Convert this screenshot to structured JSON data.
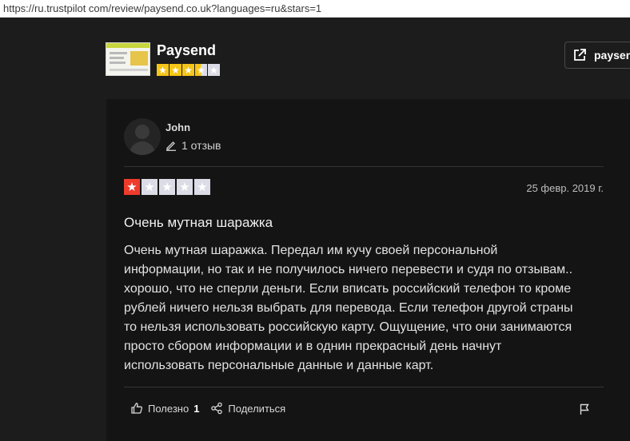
{
  "browser": {
    "url": "https://ru.trustpilot com/review/paysend.co.uk?languages=ru&stars=1"
  },
  "company": {
    "name": "Paysend",
    "stars": 3.5,
    "visit_label": "paysen",
    "star_color": "#f5c518"
  },
  "review": {
    "author": "John",
    "review_count": "1 отзыв",
    "rating": 1,
    "rating_color": "#ee3b2c",
    "date": "25 февр. 2019 г.",
    "title": "Очень мутная шаражка",
    "body_lines": [
      "Очень мутная шаражка. Передал им кучу своей персональной",
      "информации, но так и не получилось ничего перевести и судя по отзывам..",
      "хорошо, что не сперли деньги. Если вписать российский телефон то кроме",
      "рублей ничего нельзя выбрать для перевода. Если телефон другой страны",
      "то нельзя использовать российскую карту. Ощущение, что они занимаются",
      "просто сбором информации и в однин прекрасный день начнут",
      "использовать персональные данные и данные карт."
    ]
  },
  "actions": {
    "useful_label": "Полезно",
    "useful_count": "1",
    "share_label": "Поделиться"
  },
  "icons": {
    "external": "external-link-icon",
    "pencil": "pencil-icon",
    "thumb": "thumbs-up-icon",
    "share": "share-icon",
    "flag": "flag-icon"
  }
}
